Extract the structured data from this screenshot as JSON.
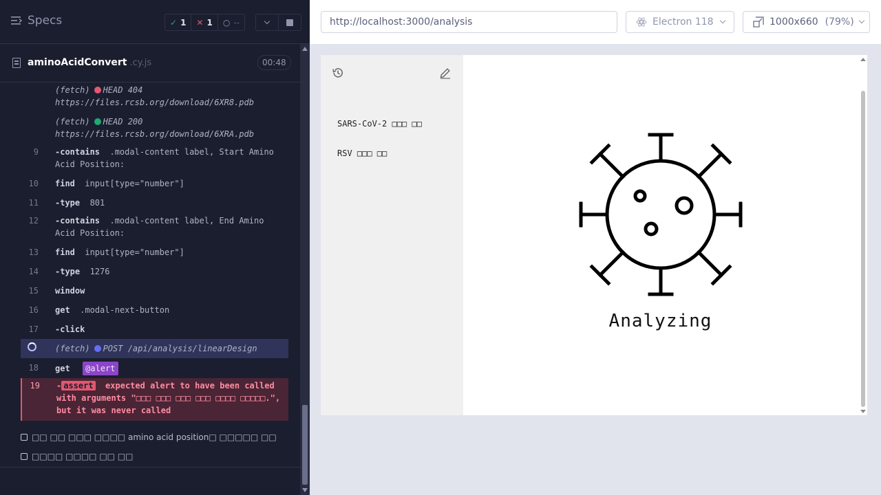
{
  "reporter": {
    "specs_label": "Specs",
    "stats": {
      "passed": "1",
      "failed": "1",
      "pending": "--"
    },
    "file": {
      "name": "aminoAcidConvert",
      "ext": ".cy.js",
      "duration": "00:48"
    },
    "log": [
      {
        "num": "",
        "kind": "fetch",
        "prefix": "(fetch)",
        "status_color": "red",
        "method": "HEAD 404",
        "url": "https://files.rcsb.org/download/6XR8.pdb"
      },
      {
        "num": "",
        "kind": "fetch",
        "prefix": "(fetch)",
        "status_color": "green",
        "method": "HEAD 200",
        "url": "https://files.rcsb.org/download/6XRA.pdb"
      },
      {
        "num": "9",
        "cmd": "-contains",
        "arg": ".modal-content label, Start Amino Acid Position:"
      },
      {
        "num": "10",
        "cmd": "find",
        "arg": "input[type=\"number\"]"
      },
      {
        "num": "11",
        "cmd": "-type",
        "arg": "801"
      },
      {
        "num": "12",
        "cmd": "-contains",
        "arg": ".modal-content label, End Amino Acid Position:"
      },
      {
        "num": "13",
        "cmd": "find",
        "arg": "input[type=\"number\"]"
      },
      {
        "num": "14",
        "cmd": "-type",
        "arg": "1276"
      },
      {
        "num": "15",
        "cmd": "window",
        "arg": ""
      },
      {
        "num": "16",
        "cmd": "get",
        "arg": ".modal-next-button"
      },
      {
        "num": "17",
        "cmd": "-click",
        "arg": ""
      },
      {
        "num": "",
        "kind": "pending-fetch",
        "prefix": "(fetch)",
        "method": "POST /api/analysis/linearDesign"
      },
      {
        "num": "18",
        "cmd": "get",
        "alias": "@alert"
      },
      {
        "num": "19",
        "kind": "assert",
        "badge": "assert",
        "message": "expected alert to have been called with arguments \"□□□ □□□ □□□ □□□ □□□□ □□□□□.\", but it was never called"
      }
    ],
    "tests": [
      "□□ □□ □□□ □□□□ amino acid position□ □□□□□ □□",
      "□□□□ □□□□ □□ □□"
    ]
  },
  "aut": {
    "url": "http://localhost:3000/analysis",
    "browser": "Electron 118",
    "viewport": "1000x660",
    "scale": "(79%)",
    "app": {
      "viruses": [
        "SARS-CoV-2 □□□ □□",
        "RSV □□□ □□"
      ],
      "status_text": "Analyzing"
    }
  },
  "colors": {
    "pass": "#1fa971",
    "fail": "#e45770",
    "pending": "#6470f3",
    "alias": "#8c45c8",
    "reporter_bg": "#1b1e2e"
  },
  "icons": [
    "menu-icon",
    "check-icon",
    "x-icon",
    "spinner-icon",
    "chevron-down-icon",
    "stop-icon",
    "file-icon",
    "history-icon",
    "edit-icon",
    "virus-icon",
    "browser-icon",
    "viewport-icon"
  ]
}
